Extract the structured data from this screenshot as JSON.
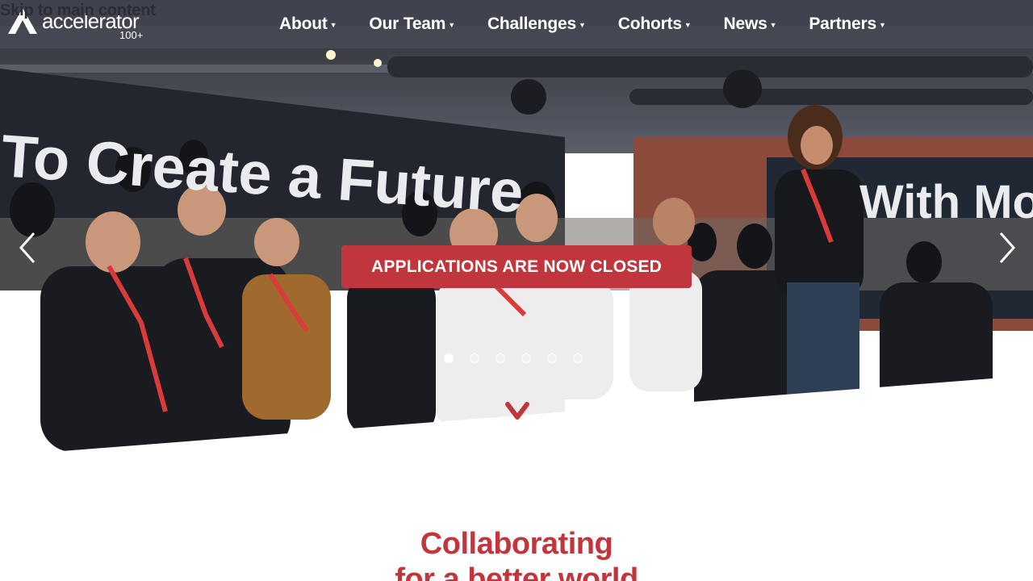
{
  "skip_link": {
    "label": "Skip to main content"
  },
  "brand": {
    "name": "accelerator",
    "suffix": "100+",
    "logo_icon": "a-shape-logo",
    "accent_color": "#c0363c",
    "nav_bg": "#1c1e2c"
  },
  "nav": {
    "items": [
      {
        "label": "About",
        "has_dropdown": true
      },
      {
        "label": "Our Team",
        "has_dropdown": true
      },
      {
        "label": "Challenges",
        "has_dropdown": true
      },
      {
        "label": "Cohorts",
        "has_dropdown": true
      },
      {
        "label": "News",
        "has_dropdown": true
      },
      {
        "label": "Partners",
        "has_dropdown": true
      }
    ],
    "dropdown_icon": "caret-down-icon"
  },
  "hero": {
    "photo_wall_text_left": "To Create a Future",
    "photo_wall_text_right": "With Mo",
    "cta_label": "APPLICATIONS ARE NOW CLOSED",
    "prev_icon": "chevron-left-icon",
    "next_icon": "chevron-right-icon",
    "slide_count": 6,
    "active_slide": 1,
    "scroll_icon": "chevron-down-icon"
  },
  "section": {
    "title_line1": "Collaborating",
    "title_line2": "for a better world"
  }
}
